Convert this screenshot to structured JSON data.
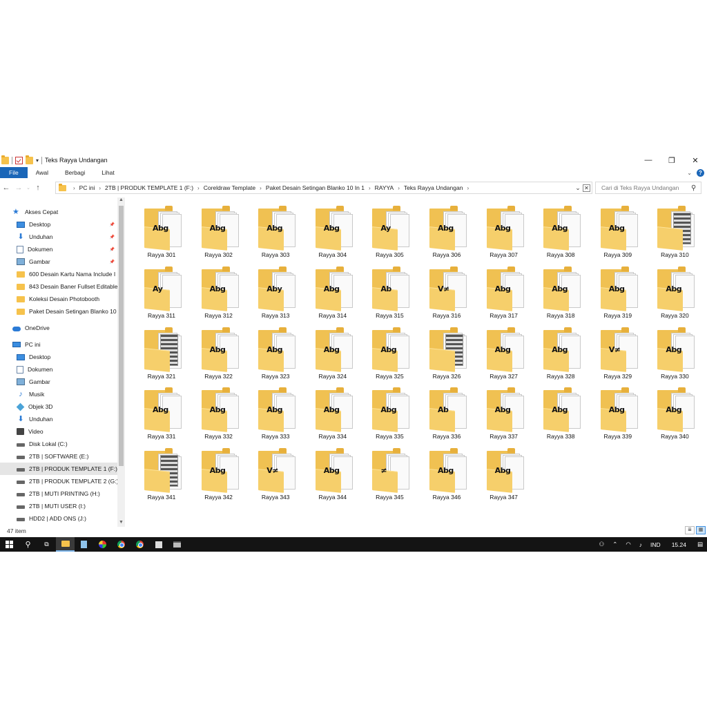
{
  "window": {
    "title": "Teks Rayya Undangan",
    "minimize": "—",
    "maximize": "❐",
    "close": "✕"
  },
  "ribbon": {
    "tabs": [
      "File",
      "Awal",
      "Berbagi",
      "Lihat"
    ],
    "expand": "⌄",
    "help": "?"
  },
  "address": {
    "crumbs": [
      "PC ini",
      "2TB | PRODUK TEMPLATE 1 (F:)",
      "Coreldraw Template",
      "Paket Desain Setingan Blanko 10 In 1",
      "RAYYA",
      "Teks Rayya Undangan"
    ],
    "search_placeholder": "Cari di Teks Rayya Undangan"
  },
  "nav": {
    "items": [
      {
        "label": "Akses Cepat",
        "icon": "star-icon",
        "pinned": false
      },
      {
        "label": "Desktop",
        "icon": "desktop-icon",
        "pinned": true
      },
      {
        "label": "Unduhan",
        "icon": "download-icon",
        "pinned": true
      },
      {
        "label": "Dokumen",
        "icon": "document-icon",
        "pinned": true
      },
      {
        "label": "Gambar",
        "icon": "pictures-icon",
        "pinned": true
      },
      {
        "label": "600 Desain Kartu Nama Include I",
        "icon": "folder-icon",
        "pinned": false
      },
      {
        "label": "843 Desain Baner Fullset Editable",
        "icon": "folder-icon",
        "pinned": false
      },
      {
        "label": "Koleksi Desain Photobooth",
        "icon": "folder-icon",
        "pinned": false
      },
      {
        "label": "Paket Desain Setingan Blanko 10",
        "icon": "folder-icon",
        "pinned": false
      },
      {
        "label": "OneDrive",
        "icon": "cloud-icon",
        "pinned": false
      },
      {
        "label": "PC ini",
        "icon": "computer-icon",
        "pinned": false
      },
      {
        "label": "Desktop",
        "icon": "desktop-icon",
        "pinned": false
      },
      {
        "label": "Dokumen",
        "icon": "document-icon",
        "pinned": false
      },
      {
        "label": "Gambar",
        "icon": "pictures-icon",
        "pinned": false
      },
      {
        "label": "Musik",
        "icon": "music-icon",
        "pinned": false
      },
      {
        "label": "Objek 3D",
        "icon": "objects-3d-icon",
        "pinned": false
      },
      {
        "label": "Unduhan",
        "icon": "download-icon",
        "pinned": false
      },
      {
        "label": "Video",
        "icon": "video-icon",
        "pinned": false
      },
      {
        "label": "Disk Lokal (C:)",
        "icon": "drive-icon",
        "pinned": false
      },
      {
        "label": "2TB | SOFTWARE (E:)",
        "icon": "drive-icon",
        "pinned": false
      },
      {
        "label": "2TB | PRODUK TEMPLATE 1 (F:)",
        "icon": "drive-icon",
        "pinned": false,
        "selected": true
      },
      {
        "label": "2TB | PRODUK TEMPLATE 2 (G:)",
        "icon": "drive-icon",
        "pinned": false
      },
      {
        "label": "2TB | MUTI PRINTING (H:)",
        "icon": "drive-icon",
        "pinned": false
      },
      {
        "label": "2TB | MUTI USER (I:)",
        "icon": "drive-icon",
        "pinned": false
      },
      {
        "label": "HDD2 | ADD ONS (J:)",
        "icon": "drive-icon",
        "pinned": false
      }
    ]
  },
  "files": {
    "names": [
      "Rayya 301",
      "Rayya 302",
      "Rayya 303",
      "Rayya 304",
      "Rayya 305",
      "Rayya 306",
      "Rayya 307",
      "Rayya 308",
      "Rayya 309",
      "Rayya 310",
      "Rayya 311",
      "Rayya 312",
      "Rayya 313",
      "Rayya 314",
      "Rayya 315",
      "Rayya 316",
      "Rayya 317",
      "Rayya 318",
      "Rayya 319",
      "Rayya 320",
      "Rayya 321",
      "Rayya 322",
      "Rayya 323",
      "Rayya 324",
      "Rayya 325",
      "Rayya 326",
      "Rayya 327",
      "Rayya 328",
      "Rayya 329",
      "Rayya 330",
      "Rayya 331",
      "Rayya 332",
      "Rayya 333",
      "Rayya 334",
      "Rayya 335",
      "Rayya 336",
      "Rayya 337",
      "Rayya 338",
      "Rayya 339",
      "Rayya 340",
      "Rayya 341",
      "Rayya 342",
      "Rayya 343",
      "Rayya 344",
      "Rayya 345",
      "Rayya 346",
      "Rayya 347"
    ],
    "previews": [
      "Abg",
      "Abg",
      "Abg",
      "Abg",
      "Ay",
      "Abg",
      "Abg",
      "Abg",
      "Abg",
      "",
      "Ay",
      "Abg",
      "Aby",
      "Abg",
      "Ab",
      "V≠",
      "Abg",
      "Abg",
      "Abg",
      "Abg",
      "",
      "Abg",
      "Abg",
      "Abg",
      "Abg",
      "",
      "Abg",
      "Abg",
      "V≠",
      "Abg",
      "Abg",
      "Abg",
      "Abg",
      "Abg",
      "Abg",
      "Ab",
      "Abg",
      "Abg",
      "Abg",
      "Abg",
      "",
      "Abg",
      "V≠",
      "Abg",
      "≠",
      "Abg",
      "Abg"
    ],
    "image_previews": [
      10,
      21,
      26,
      41
    ]
  },
  "status": {
    "count": "47 item"
  },
  "taskbar": {
    "language": "IND",
    "time": "15.24"
  }
}
